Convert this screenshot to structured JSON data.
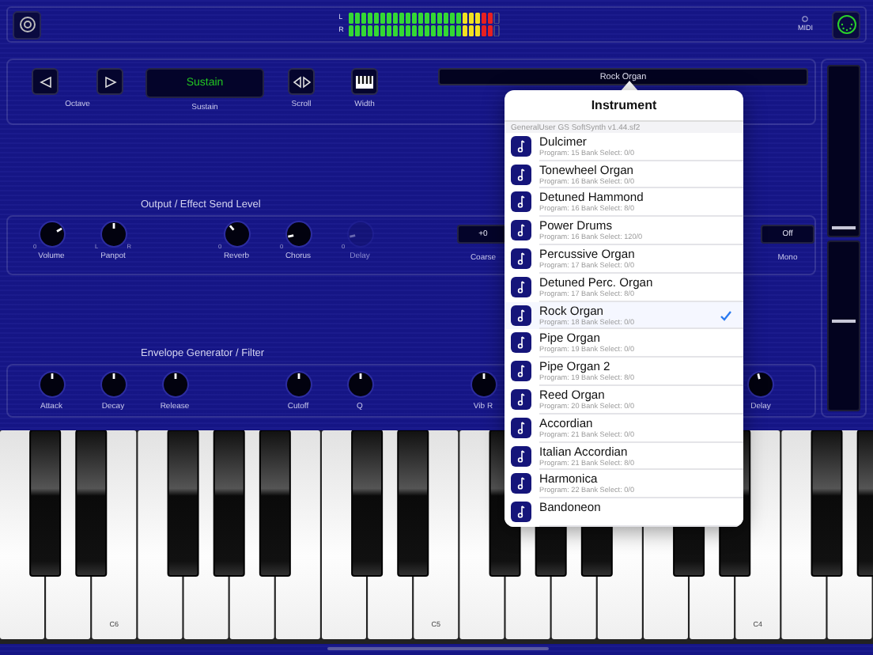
{
  "top_bar": {
    "meter": [
      {
        "label": "L",
        "level": 0.96
      },
      {
        "label": "R",
        "level": 0.96
      }
    ],
    "midi_label": "MIDI"
  },
  "controls_panel": {
    "octave_label": "Octave",
    "sustain": {
      "value": "Sustain",
      "label": "Sustain"
    },
    "scroll_label": "Scroll",
    "width_label": "Width",
    "instrument": "Rock Organ"
  },
  "output_panel": {
    "title": "Output / Effect Send Level",
    "controls": [
      {
        "kind": "knob",
        "label": "Volume",
        "level": 0.72,
        "min_label": "0",
        "disabled": false
      },
      {
        "kind": "knob",
        "label": "Panpot",
        "level": 0.5,
        "min_label": "L",
        "max_label": "R",
        "disabled": false
      },
      {
        "kind": "knob",
        "label": "Reverb",
        "level": 0.35,
        "min_label": "0",
        "disabled": false
      },
      {
        "kind": "knob",
        "label": "Chorus",
        "level": 0.12,
        "min_label": "0",
        "disabled": false
      },
      {
        "kind": "knob",
        "label": "Delay",
        "level": 0.12,
        "min_label": "0",
        "disabled": true
      },
      {
        "kind": "display",
        "label": "Coarse",
        "value": "+0",
        "disabled": false
      },
      {
        "kind": "display",
        "label": "Mono",
        "value": "Off",
        "disabled": false
      }
    ]
  },
  "envelope_panel": {
    "title": "Envelope Generator / Filter",
    "controls": [
      {
        "kind": "knob",
        "label": "Attack",
        "level": 0.5,
        "disabled": false
      },
      {
        "kind": "knob",
        "label": "Decay",
        "level": 0.5,
        "disabled": false
      },
      {
        "kind": "knob",
        "label": "Release",
        "level": 0.5,
        "disabled": false
      },
      {
        "kind": "knob",
        "label": "Cutoff",
        "level": 0.5,
        "disabled": false
      },
      {
        "kind": "knob",
        "label": "Q",
        "level": 0.5,
        "disabled": false
      },
      {
        "kind": "knob",
        "label": "Vib R",
        "level": 0.5,
        "disabled": false
      },
      {
        "kind": "knob",
        "label": "Delay",
        "level": 0.45,
        "disabled": false
      }
    ]
  },
  "faders": [
    {
      "level": 0.03
    },
    {
      "level": 0.52
    }
  ],
  "keyboard": {
    "labels": [
      "C6",
      "C5",
      "C4"
    ]
  },
  "instrument_popover": {
    "title": "Instrument",
    "section": "GeneralUser GS SoftSynth v1.44.sf2",
    "items": [
      {
        "name": "Dulcimer",
        "detail": "Program: 15 Bank Select: 0/0",
        "selected": false
      },
      {
        "name": "Tonewheel Organ",
        "detail": "Program: 16 Bank Select: 0/0",
        "selected": false
      },
      {
        "name": "Detuned Hammond",
        "detail": "Program: 16 Bank Select: 8/0",
        "selected": false
      },
      {
        "name": "Power Drums",
        "detail": "Program: 16 Bank Select: 120/0",
        "selected": false
      },
      {
        "name": "Percussive Organ",
        "detail": "Program: 17 Bank Select: 0/0",
        "selected": false
      },
      {
        "name": "Detuned Perc. Organ",
        "detail": "Program: 17 Bank Select: 8/0",
        "selected": false
      },
      {
        "name": "Rock Organ",
        "detail": "Program: 18 Bank Select: 0/0",
        "selected": true
      },
      {
        "name": "Pipe Organ",
        "detail": "Program: 19 Bank Select: 0/0",
        "selected": false
      },
      {
        "name": "Pipe Organ 2",
        "detail": "Program: 19 Bank Select: 8/0",
        "selected": false
      },
      {
        "name": "Reed Organ",
        "detail": "Program: 20 Bank Select: 0/0",
        "selected": false
      },
      {
        "name": "Accordian",
        "detail": "Program: 21 Bank Select: 0/0",
        "selected": false
      },
      {
        "name": "Italian Accordian",
        "detail": "Program: 21 Bank Select: 8/0",
        "selected": false
      },
      {
        "name": "Harmonica",
        "detail": "Program: 22 Bank Select: 0/0",
        "selected": false
      },
      {
        "name": "Bandoneon",
        "selected": false
      }
    ]
  }
}
